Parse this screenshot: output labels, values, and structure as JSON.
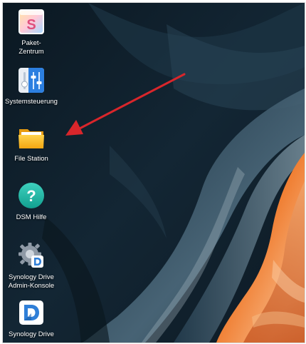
{
  "desktop": {
    "icons": [
      {
        "id": "paket-zentrum",
        "label_lines": [
          "Paket-",
          "Zentrum"
        ],
        "icon": "package-center-icon"
      },
      {
        "id": "systemsteuerung",
        "label_lines": [
          "Systemsteuerung"
        ],
        "icon": "control-panel-icon"
      },
      {
        "id": "file-station",
        "label_lines": [
          "File Station"
        ],
        "icon": "folder-icon"
      },
      {
        "id": "dsm-hilfe",
        "label_lines": [
          "DSM Hilfe"
        ],
        "icon": "help-icon"
      },
      {
        "id": "synology-drive-admin",
        "label_lines": [
          "Synology Drive",
          "Admin-Konsole"
        ],
        "icon": "drive-admin-console-icon"
      },
      {
        "id": "synology-drive",
        "label_lines": [
          "Synology Drive"
        ],
        "icon": "synology-drive-icon"
      }
    ]
  },
  "annotation": {
    "type": "arrow",
    "color": "#d9262b",
    "points_to": "file-station"
  },
  "colors": {
    "arrow": "#d9262b",
    "folder": "#f6b820",
    "help": "#1fb6a5",
    "drive_blue": "#2f7fd8",
    "wallpaper_dark": "#0e1b26",
    "wallpaper_rock": "#e56a24"
  }
}
